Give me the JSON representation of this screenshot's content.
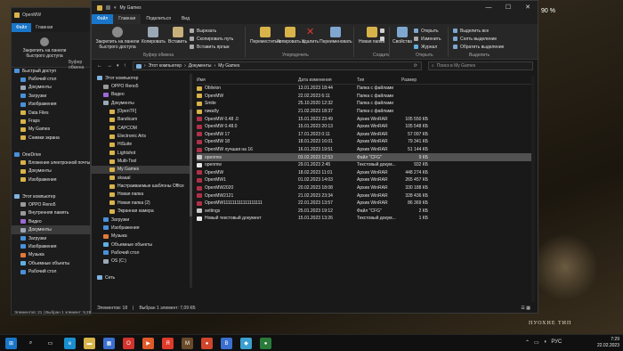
{
  "desktop": {
    "battery": "90 %",
    "hud_text": "ПУОХНЕ ТИП"
  },
  "back_window": {
    "title": "OpenMW",
    "tabs": [
      "Файл",
      "Главная"
    ],
    "clipboard_label": "Закрепить на панели быстрого доступа",
    "clipboard_group": "Буфер обмена",
    "tree": [
      {
        "label": "Быстрый доступ",
        "icon": "star-icon",
        "color": "#4a90d9"
      },
      {
        "label": "Рабочий стол",
        "icon": "folder-icon",
        "color": "#4a90d9"
      },
      {
        "label": "Документы",
        "icon": "folder-icon",
        "color": "#9aa7b5"
      },
      {
        "label": "Загрузки",
        "icon": "download-icon",
        "color": "#4a90d9"
      },
      {
        "label": "Изображения",
        "icon": "folder-icon",
        "color": "#4a90d9"
      },
      {
        "label": "Data Files",
        "icon": "folder-icon",
        "color": "#d8b34a"
      },
      {
        "label": "Fraps",
        "icon": "folder-icon",
        "color": "#d8b34a"
      },
      {
        "label": "My Games",
        "icon": "folder-icon",
        "color": "#d8b34a"
      },
      {
        "label": "Снимки экрана",
        "icon": "folder-icon",
        "color": "#d8b34a"
      },
      {
        "label": "",
        "icon": "",
        "color": ""
      },
      {
        "label": "OneDrive",
        "icon": "cloud-icon",
        "color": "#4a90d9"
      },
      {
        "label": "Вложения электронной почты",
        "icon": "folder-icon",
        "color": "#d8b34a"
      },
      {
        "label": "Документы",
        "icon": "folder-icon",
        "color": "#d8b34a"
      },
      {
        "label": "Изображения",
        "icon": "folder-icon",
        "color": "#d8b34a"
      },
      {
        "label": "",
        "icon": "",
        "color": ""
      },
      {
        "label": "Этот компьютер",
        "icon": "computer-icon",
        "color": "#7fb3e0"
      },
      {
        "label": "OPPO Reno5",
        "icon": "phone-icon",
        "color": "#9a9a9a"
      },
      {
        "label": "Внутренняя память",
        "icon": "drive-icon",
        "color": "#9a9a9a"
      },
      {
        "label": "Видео",
        "icon": "video-icon",
        "color": "#9c6ad6"
      },
      {
        "label": "Документы",
        "icon": "folder-icon",
        "color": "#9aa7b5"
      },
      {
        "label": "Загрузки",
        "icon": "download-icon",
        "color": "#4a90d9"
      },
      {
        "label": "Изображения",
        "icon": "folder-icon",
        "color": "#4a90d9"
      },
      {
        "label": "Музыка",
        "icon": "music-icon",
        "color": "#e07a3a"
      },
      {
        "label": "Объемные объекты",
        "icon": "cube-icon",
        "color": "#5fb0e0"
      },
      {
        "label": "Рабочий стол",
        "icon": "folder-icon",
        "color": "#4a90d9"
      }
    ],
    "status": "Элементов: 21  |  Выбран 1 элемент: 9,28 КБ"
  },
  "window": {
    "title": "My Games",
    "tabs": [
      "Файл",
      "Главная",
      "Поделиться",
      "Вид"
    ],
    "ribbon": {
      "pin": "Закрепить на панели быстрого доступа",
      "copy": "Копировать",
      "paste": "Вставить",
      "cut": "Вырезать",
      "copy_path": "Скопировать путь",
      "paste_shortcut": "Вставить ярлык",
      "move_to": "Переместить в",
      "copy_to": "Копировать в",
      "delete": "Удалить",
      "rename": "Переименовать",
      "new_folder": "Новая папка",
      "new_item": "",
      "easy_access": "",
      "properties": "Свойства",
      "open": "Открыть",
      "edit": "Изменить",
      "history": "Журнал",
      "select_all": "Выделить все",
      "select_none": "Снять выделение",
      "invert": "Обратить выделение",
      "group_clipboard": "Буфер обмена",
      "group_organize": "Упорядочить",
      "group_create": "Создать",
      "group_open": "Открыть",
      "group_select": "Выделить"
    },
    "breadcrumb": [
      "Этот компьютер",
      "Документы",
      "My Games"
    ],
    "search_placeholder": "Поиск в My Games",
    "nav": [
      {
        "label": "Этот компьютер",
        "icon": "computer-icon",
        "color": "#7fb3e0",
        "indent": 0
      },
      {
        "label": "OPPO Reno5",
        "icon": "phone-icon",
        "color": "#9a9a9a",
        "indent": 1
      },
      {
        "label": "Видео",
        "icon": "video-icon",
        "color": "#9c6ad6",
        "indent": 1
      },
      {
        "label": "Документы",
        "icon": "folder-icon",
        "color": "#9aa7b5",
        "indent": 1
      },
      {
        "label": "[OpenTF]",
        "icon": "folder-icon",
        "color": "#d8b34a",
        "indent": 2
      },
      {
        "label": "Bandicam",
        "icon": "folder-icon",
        "color": "#d8b34a",
        "indent": 2
      },
      {
        "label": "CAPCOM",
        "icon": "folder-icon",
        "color": "#d8b34a",
        "indent": 2
      },
      {
        "label": "Electronic Arts",
        "icon": "folder-icon",
        "color": "#d8b34a",
        "indent": 2
      },
      {
        "label": "HiSuite",
        "icon": "folder-icon",
        "color": "#d8b34a",
        "indent": 2
      },
      {
        "label": "Lightshot",
        "icon": "folder-icon",
        "color": "#d8b34a",
        "indent": 2
      },
      {
        "label": "Multi-Tool",
        "icon": "folder-icon",
        "color": "#d8b34a",
        "indent": 2
      },
      {
        "label": "My Games",
        "icon": "folder-icon",
        "color": "#d8b34a",
        "indent": 2,
        "selected": true
      },
      {
        "label": "skaaal",
        "icon": "folder-icon",
        "color": "#d8b34a",
        "indent": 2
      },
      {
        "label": "Настраиваемые шаблоны Office",
        "icon": "folder-icon",
        "color": "#d8b34a",
        "indent": 2
      },
      {
        "label": "Новая папка",
        "icon": "folder-icon",
        "color": "#d8b34a",
        "indent": 2
      },
      {
        "label": "Новая папка (2)",
        "icon": "folder-icon",
        "color": "#d8b34a",
        "indent": 2
      },
      {
        "label": "Экранная камера",
        "icon": "folder-icon",
        "color": "#d8b34a",
        "indent": 2
      },
      {
        "label": "Загрузки",
        "icon": "download-icon",
        "color": "#4a90d9",
        "indent": 1
      },
      {
        "label": "Изображения",
        "icon": "folder-icon",
        "color": "#4a90d9",
        "indent": 1
      },
      {
        "label": "Музыка",
        "icon": "music-icon",
        "color": "#e07a3a",
        "indent": 1
      },
      {
        "label": "Объемные объекты",
        "icon": "cube-icon",
        "color": "#5fb0e0",
        "indent": 1
      },
      {
        "label": "Рабочий стол",
        "icon": "folder-icon",
        "color": "#4a90d9",
        "indent": 1
      },
      {
        "label": "OS (C:)",
        "icon": "drive-icon",
        "color": "#9aa7b5",
        "indent": 1
      },
      {
        "label": "",
        "icon": "",
        "color": "",
        "indent": 0
      },
      {
        "label": "Сеть",
        "icon": "network-icon",
        "color": "#7fb3e0",
        "indent": 0
      }
    ],
    "columns": [
      "Имя",
      "Дата изменения",
      "Тип",
      "Размер"
    ],
    "files": [
      {
        "name": "Oblivion",
        "date": "13.01.2023 18:44",
        "type": "Папка с файлами",
        "size": "",
        "kind": "folder"
      },
      {
        "name": "OpenMW",
        "date": "22.02.2023 6:11",
        "type": "Папка с файлами",
        "size": "",
        "kind": "folder"
      },
      {
        "name": "Smite",
        "date": "25.10.2020 12:32",
        "type": "Папка с файлами",
        "size": "",
        "kind": "folder"
      },
      {
        "name": "пикабу",
        "date": "21.02.2023 18:37",
        "type": "Папка с файлами",
        "size": "",
        "kind": "folder"
      },
      {
        "name": "OpenMW 0.48 .0",
        "date": "15.01.2023 23:49",
        "type": "Архив WinRAR",
        "size": "105 550 КБ",
        "kind": "rar"
      },
      {
        "name": "OpenMW 0.48.0",
        "date": "15.01.2023 20:13",
        "type": "Архив WinRAR",
        "size": "105 548 КБ",
        "kind": "rar"
      },
      {
        "name": "OpenMW 17",
        "date": "17.01.2023 0:11",
        "type": "Архив WinRAR",
        "size": "57 097 КБ",
        "kind": "rar"
      },
      {
        "name": "OpenMW 18",
        "date": "18.01.2023 16:01",
        "type": "Архив WinRAR",
        "size": "79 341 КБ",
        "kind": "rar"
      },
      {
        "name": "OpenMW лучшая на 16",
        "date": "16.01.2023 19:51",
        "type": "Архив WinRAR",
        "size": "51 144 КБ",
        "kind": "rar"
      },
      {
        "name": "openmw",
        "date": "03.02.2023 12:53",
        "type": "Файл \"CFG\"",
        "size": "9 КБ",
        "kind": "cfg",
        "selected": true
      },
      {
        "name": "openmw",
        "date": "29.01.2023 2:45",
        "type": "Текстовый докум...",
        "size": "932 КБ",
        "kind": "txt"
      },
      {
        "name": "OpenMW",
        "date": "18.02.2023 11:01",
        "type": "Архив WinRAR",
        "size": "448 274 КБ",
        "kind": "rar"
      },
      {
        "name": "OpenMW1",
        "date": "01.02.2023 14:03",
        "type": "Архив WinRAR",
        "size": "265 457 КБ",
        "kind": "rar"
      },
      {
        "name": "OpenMW2020",
        "date": "20.02.2023 18:08",
        "type": "Архив WinRAR",
        "size": "330 188 КБ",
        "kind": "rar"
      },
      {
        "name": "OpenMW2121",
        "date": "21.02.2023 23:34",
        "type": "Архив WinRAR",
        "size": "328 436 КБ",
        "kind": "rar"
      },
      {
        "name": "OpenMW111111111111111111",
        "date": "22.01.2023 13:57",
        "type": "Архив WinRAR",
        "size": "86 369 КБ",
        "kind": "rar"
      },
      {
        "name": "settings",
        "date": "25.01.2023 19:12",
        "type": "Файл \"CFG\"",
        "size": "2 КБ",
        "kind": "cfg"
      },
      {
        "name": "Новый текстовый документ",
        "date": "15.01.2023 13:26",
        "type": "Текстовый докум...",
        "size": "1 КБ",
        "kind": "txt"
      }
    ],
    "status": [
      "Элементов: 18",
      "Выбран 1 элемент: 7,09 КБ"
    ]
  },
  "taskbar": {
    "apps": [
      {
        "name": "start-icon",
        "color": "#1976c9",
        "glyph": "⊞"
      },
      {
        "name": "search-icon",
        "color": "transparent",
        "glyph": "⌕"
      },
      {
        "name": "task-view-icon",
        "color": "transparent",
        "glyph": "▭"
      },
      {
        "name": "edge-icon",
        "color": "#1a8fd0",
        "glyph": "e"
      },
      {
        "name": "explorer-icon",
        "color": "#d8b34a",
        "glyph": "▬"
      },
      {
        "name": "store-icon",
        "color": "#3a6fd0",
        "glyph": "▦"
      },
      {
        "name": "opera-icon",
        "color": "#d0342c",
        "glyph": "O"
      },
      {
        "name": "media-icon",
        "color": "#e05a2a",
        "glyph": "▶"
      },
      {
        "name": "yandex-icon",
        "color": "#e03a2a",
        "glyph": "Я"
      },
      {
        "name": "game-icon",
        "color": "#6a4a2a",
        "glyph": "M"
      },
      {
        "name": "player-icon",
        "color": "#d0452c",
        "glyph": "●"
      },
      {
        "name": "vk-icon",
        "color": "#3a6fd0",
        "glyph": "B"
      },
      {
        "name": "app-icon",
        "color": "#3aa0d0",
        "glyph": "◆"
      },
      {
        "name": "app2-icon",
        "color": "#2a7a3a",
        "glyph": "●"
      }
    ],
    "lang": "РУС",
    "time": "7:29",
    "date": "22.02.2023"
  }
}
